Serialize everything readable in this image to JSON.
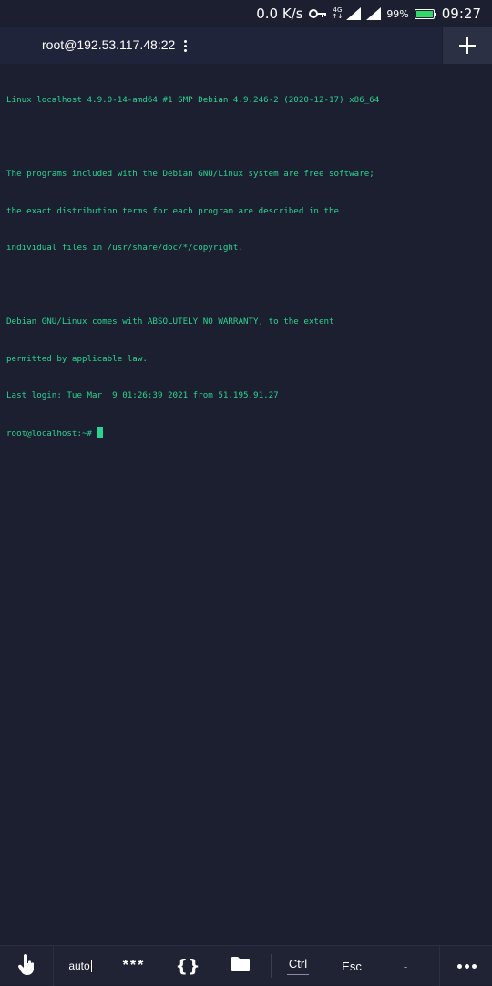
{
  "status_bar": {
    "net_speed": "0.0 K/s",
    "network_type": "4G",
    "network_sub": "↑↓",
    "battery_percent": "99%",
    "battery_level": 0.99,
    "time": "09:27"
  },
  "header": {
    "session_title": "root@192.53.117.48:22"
  },
  "terminal": {
    "lines": [
      "Linux localhost 4.9.0-14-amd64 #1 SMP Debian 4.9.246-2 (2020-12-17) x86_64",
      "",
      "The programs included with the Debian GNU/Linux system are free software;",
      "the exact distribution terms for each program are described in the",
      "individual files in /usr/share/doc/*/copyright.",
      "",
      "Debian GNU/Linux comes with ABSOLUTELY NO WARRANTY, to the extent",
      "permitted by applicable law.",
      "Last login: Tue Mar  9 01:26:39 2021 from 51.195.91.27"
    ],
    "prompt": "root@localhost:~# "
  },
  "toolbar": {
    "auto_label": "auto",
    "password_label": "***",
    "snippets_label": "{}",
    "ctrl_label": "Ctrl",
    "esc_label": "Esc",
    "dash_label": "-"
  },
  "colors": {
    "background": "#1b1f2f",
    "terminal_text": "#2bd391",
    "battery_fill": "#33d86b"
  },
  "icons": {
    "key": "key-icon",
    "signal": "signal-icon",
    "battery": "battery-icon",
    "kebab": "kebab-menu-icon",
    "plus": "plus-icon",
    "touch": "touch-hand-icon",
    "folder": "folder-icon",
    "more": "more-horizontal-icon"
  }
}
